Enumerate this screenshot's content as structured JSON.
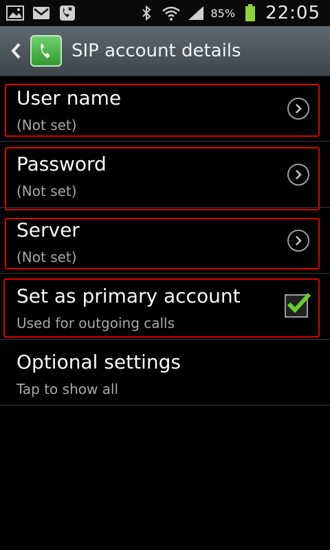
{
  "status_bar": {
    "icons_left": [
      "gallery-icon",
      "gmail-icon",
      "missed-call-icon"
    ],
    "icons_right": [
      "bluetooth-icon",
      "wifi-icon",
      "signal-icon",
      "battery-icon"
    ],
    "battery_percent": "85%",
    "time": "22:05"
  },
  "action_bar": {
    "title": "SIP account details"
  },
  "items": [
    {
      "title": "User name",
      "subtitle": "(Not set)",
      "control": "chevron"
    },
    {
      "title": "Password",
      "subtitle": "(Not set)",
      "control": "chevron"
    },
    {
      "title": "Server",
      "subtitle": "(Not set)",
      "control": "chevron"
    },
    {
      "title": "Set as primary account",
      "subtitle": "Used for outgoing calls",
      "control": "checkbox",
      "checked": true
    },
    {
      "title": "Optional settings",
      "subtitle": "Tap to show all",
      "control": "none"
    }
  ],
  "colors": {
    "highlight_box": "#e00000",
    "check": "#66cc33"
  }
}
